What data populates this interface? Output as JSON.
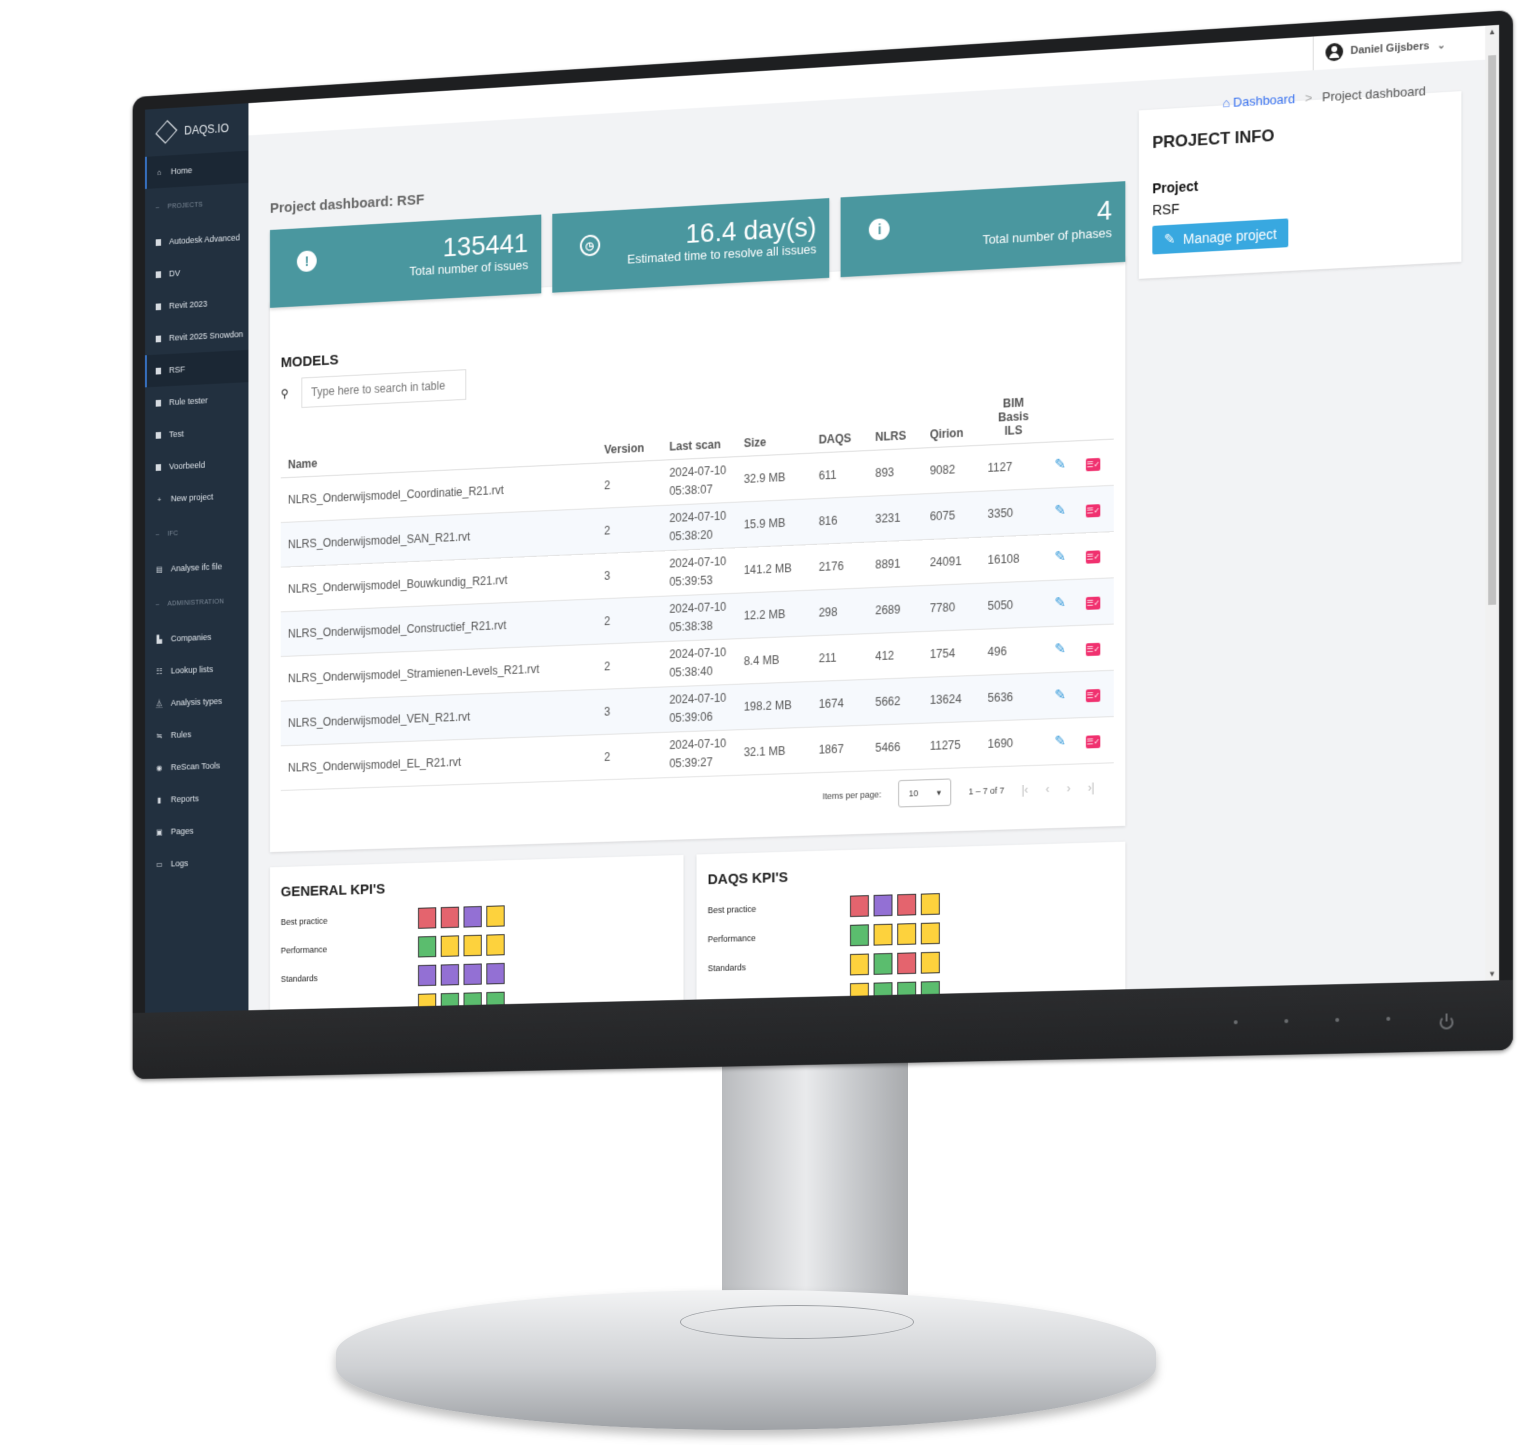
{
  "app": {
    "brand": "DAQS.IO"
  },
  "user": {
    "name": "Daniel Gijsbers"
  },
  "breadcrumb": {
    "home": "Dashboard",
    "separator": ">",
    "current": "Project dashboard"
  },
  "sidebar": {
    "home": "Home",
    "sections": {
      "projects": "PROJECTS",
      "ifc": "IFC",
      "administration": "ADMINISTRATION"
    },
    "projects": [
      "Autodesk Advanced",
      "DV",
      "Revit 2023",
      "Revit 2025 Snowdon",
      "RSF",
      "Rule tester",
      "Test",
      "Voorbeeld"
    ],
    "new_project": "New project",
    "ifc_items": [
      "Analyse ifc file"
    ],
    "admin_items": [
      "Companies",
      "Lookup lists",
      "Analysis types",
      "Rules",
      "ReScan Tools",
      "Reports",
      "Pages",
      "Logs"
    ]
  },
  "page": {
    "title": "Project dashboard: RSF"
  },
  "stats": [
    {
      "icon": "alert-octagon-icon",
      "value": "135441",
      "label": "Total number of issues"
    },
    {
      "icon": "clock-icon",
      "value": "16.4 day(s)",
      "label": "Estimated time to resolve all issues"
    },
    {
      "icon": "info-icon",
      "value": "4",
      "label": "Total number of phases"
    }
  ],
  "models": {
    "title": "MODELS",
    "search_placeholder": "Type here to search in table",
    "columns": [
      "Name",
      "Version",
      "Last scan",
      "Size",
      "DAQS",
      "NLRS",
      "Qirion",
      "BIM Basis ILS"
    ],
    "rows": [
      {
        "name": "NLRS_Onderwijsmodel_Coordinatie_R21.rvt",
        "version": "2",
        "last_scan": "2024-07-10 05:38:07",
        "size": "32.9 MB",
        "daqs": "611",
        "nlrs": "893",
        "qirion": "9082",
        "bim": "1127"
      },
      {
        "name": "NLRS_Onderwijsmodel_SAN_R21.rvt",
        "version": "2",
        "last_scan": "2024-07-10 05:38:20",
        "size": "15.9 MB",
        "daqs": "816",
        "nlrs": "3231",
        "qirion": "6075",
        "bim": "3350"
      },
      {
        "name": "NLRS_Onderwijsmodel_Bouwkundig_R21.rvt",
        "version": "3",
        "last_scan": "2024-07-10 05:39:53",
        "size": "141.2 MB",
        "daqs": "2176",
        "nlrs": "8891",
        "qirion": "24091",
        "bim": "16108"
      },
      {
        "name": "NLRS_Onderwijsmodel_Constructief_R21.rvt",
        "version": "2",
        "last_scan": "2024-07-10 05:38:38",
        "size": "12.2 MB",
        "daqs": "298",
        "nlrs": "2689",
        "qirion": "7780",
        "bim": "5050"
      },
      {
        "name": "NLRS_Onderwijsmodel_Stramienen-Levels_R21.rvt",
        "version": "2",
        "last_scan": "2024-07-10 05:38:40",
        "size": "8.4 MB",
        "daqs": "211",
        "nlrs": "412",
        "qirion": "1754",
        "bim": "496"
      },
      {
        "name": "NLRS_Onderwijsmodel_VEN_R21.rvt",
        "version": "3",
        "last_scan": "2024-07-10 05:39:06",
        "size": "198.2 MB",
        "daqs": "1674",
        "nlrs": "5662",
        "qirion": "13624",
        "bim": "5636"
      },
      {
        "name": "NLRS_Onderwijsmodel_EL_R21.rvt",
        "version": "2",
        "last_scan": "2024-07-10 05:39:27",
        "size": "32.1 MB",
        "daqs": "1867",
        "nlrs": "5466",
        "qirion": "11275",
        "bim": "1690"
      }
    ],
    "paginator": {
      "label": "Items per page:",
      "page_size": "10",
      "range": "1 – 7 of 7"
    }
  },
  "kpi_colors": {
    "red": "#e4646e",
    "purple": "#9370d4",
    "yellow": "#fdd23d",
    "green": "#5bbd6e"
  },
  "general_kpis": {
    "title": "GENERAL KPI'S",
    "rows": [
      {
        "label": "Best practice",
        "cells": [
          "red",
          "red",
          "purple",
          "yellow"
        ]
      },
      {
        "label": "Performance",
        "cells": [
          "green",
          "yellow",
          "yellow",
          "yellow"
        ]
      },
      {
        "label": "Standards",
        "cells": [
          "purple",
          "purple",
          "purple",
          "purple"
        ]
      },
      {
        "label": "",
        "cells": [
          "yellow",
          "green",
          "green",
          "green"
        ]
      }
    ]
  },
  "daqs_kpis": {
    "title": "DAQS KPI'S",
    "rows": [
      {
        "label": "Best practice",
        "cells": [
          "red",
          "purple",
          "red",
          "yellow"
        ]
      },
      {
        "label": "Performance",
        "cells": [
          "green",
          "yellow",
          "yellow",
          "yellow"
        ]
      },
      {
        "label": "Standards",
        "cells": [
          "yellow",
          "green",
          "red",
          "yellow"
        ]
      },
      {
        "label": "",
        "cells": [
          "yellow",
          "green",
          "green",
          "green"
        ]
      }
    ]
  },
  "project_info": {
    "title": "PROJECT INFO",
    "label": "Project",
    "value": "RSF",
    "button": "Manage project"
  }
}
